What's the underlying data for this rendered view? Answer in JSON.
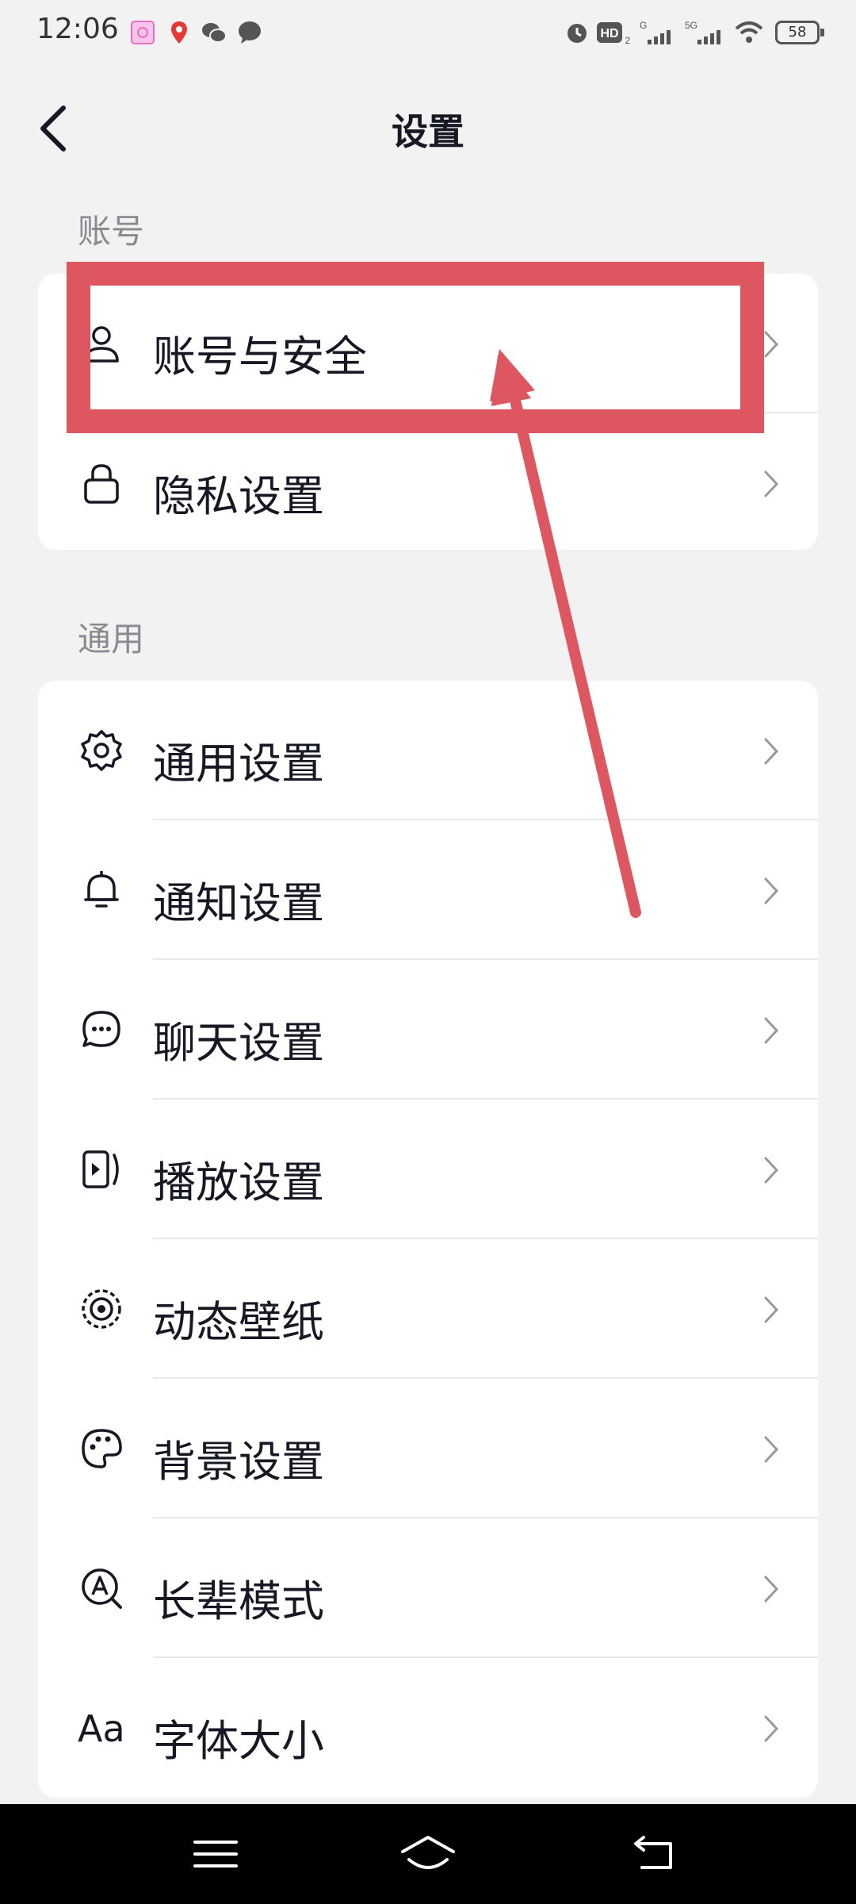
{
  "status_bar": {
    "time": "12:06",
    "battery": "58",
    "icons": [
      "photo-app-icon",
      "map-pin-icon",
      "wechat-icon",
      "chat-bubble-icon",
      "alarm-icon",
      "hd-icon",
      "signal-icon",
      "signal-5g-icon",
      "wifi-icon"
    ]
  },
  "header": {
    "title": "设置",
    "back_icon": "chevron-left-icon"
  },
  "sections": [
    {
      "title": "账号",
      "items": [
        {
          "label": "账号与安全",
          "icon": "user-icon"
        },
        {
          "label": "隐私设置",
          "icon": "lock-icon"
        }
      ]
    },
    {
      "title": "通用",
      "items": [
        {
          "label": "通用设置",
          "icon": "gear-icon"
        },
        {
          "label": "通知设置",
          "icon": "bell-icon"
        },
        {
          "label": "聊天设置",
          "icon": "chat-icon"
        },
        {
          "label": "播放设置",
          "icon": "play-icon"
        },
        {
          "label": "动态壁纸",
          "icon": "wallpaper-icon"
        },
        {
          "label": "背景设置",
          "icon": "palette-icon"
        },
        {
          "label": "长辈模式",
          "icon": "elder-mode-icon"
        },
        {
          "label": "字体大小",
          "icon": "font-size-icon",
          "glyph": "Aa"
        }
      ]
    }
  ],
  "nav_bar": {
    "icons": [
      "menu-icon",
      "home-icon",
      "back-icon"
    ]
  },
  "colors": {
    "annotation": "#de5660",
    "background": "#f2f2f2",
    "card": "#ffffff",
    "text": "#161823",
    "section_title": "#8a8b91"
  }
}
